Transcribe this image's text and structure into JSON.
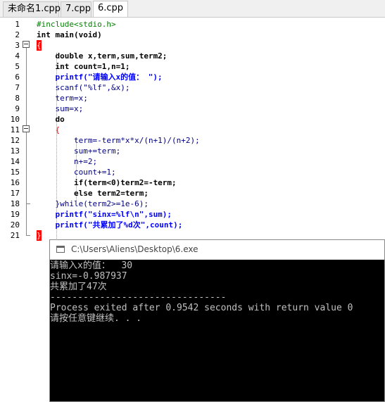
{
  "tabs": [
    {
      "label": "未命名1.cpp",
      "active": false
    },
    {
      "label": "7.cpp",
      "active": false
    },
    {
      "label": "6.cpp",
      "active": true
    }
  ],
  "editor": {
    "line_numbers": [
      "1",
      "2",
      "3",
      "4",
      "5",
      "6",
      "7",
      "8",
      "9",
      "10",
      "11",
      "12",
      "13",
      "14",
      "15",
      "16",
      "17",
      "18",
      "19",
      "20",
      "21"
    ],
    "lines": [
      "#include<stdio.h>",
      "int main(void)",
      "{",
      "    double x,term,sum,term2;",
      "    int count=1,n=1;",
      "    printf(\"请输入x的值： \");",
      "    scanf(\"%lf\",&x);",
      "    term=x;",
      "    sum=x;",
      "    do",
      "    {",
      "        term=-term*x*x/(n+1)/(n+2);",
      "        sum+=term;",
      "        n+=2;",
      "        count+=1;",
      "        if(term<0)term2=-term;",
      "        else term2=term;",
      "    }while(term2>=1e-6);",
      "    printf(\"sinx=%lf\\n\",sum);",
      "    printf(\"共累加了%d次\",count);",
      "}"
    ]
  },
  "console": {
    "title": "C:\\Users\\Aliens\\Desktop\\6.exe",
    "lines": [
      "请输入x的值：  30",
      "sinx=-0.987937",
      "共累加了47次",
      "--------------------------------",
      "Process exited after 0.9542 seconds with return value 0",
      "请按任意键继续. . ."
    ]
  }
}
